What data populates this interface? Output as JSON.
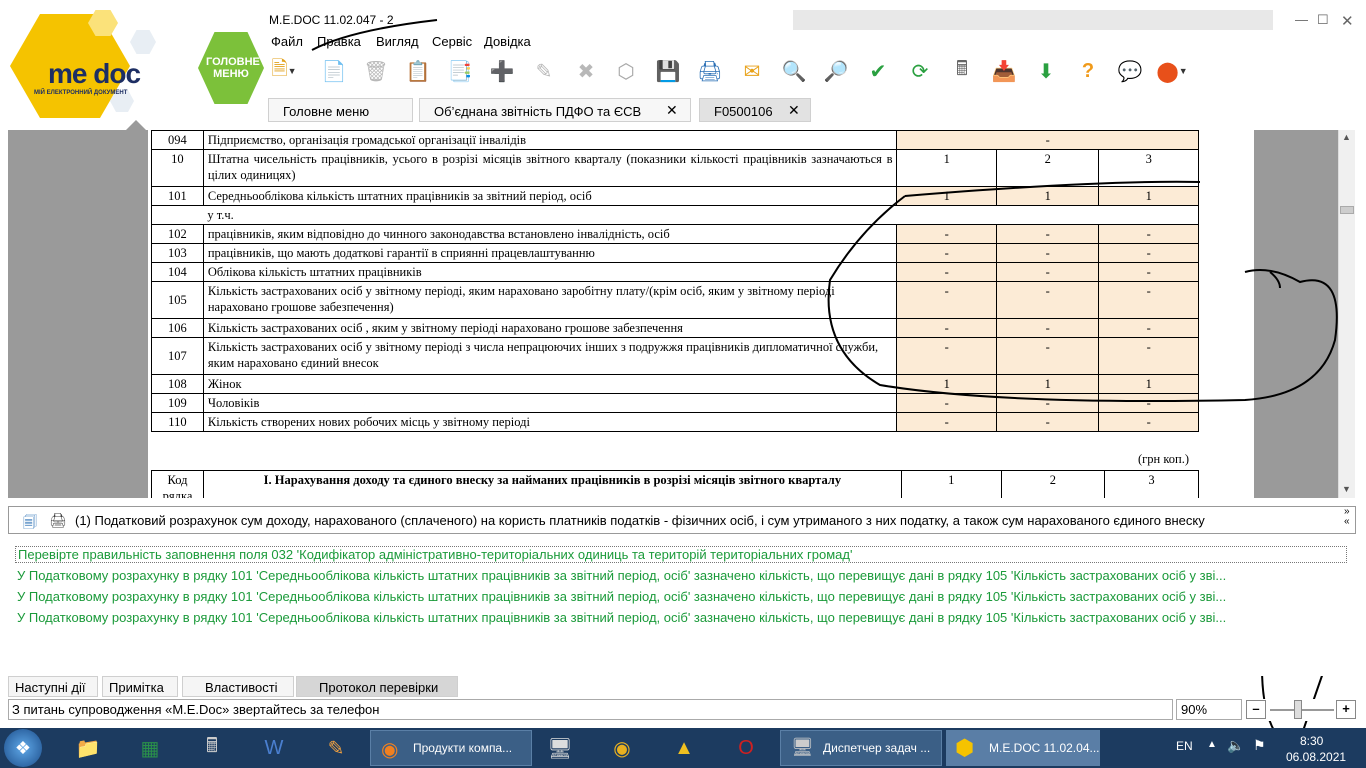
{
  "window": {
    "title": "M.E.DOC 11.02.047 - 2"
  },
  "logo": {
    "brand": "me doc",
    "tagline": "МІЙ ЕЛЕКТРОННИЙ ДОКУМЕНТ",
    "main_menu_badge": "ГОЛОВНЕ МЕНЮ"
  },
  "menu": [
    "Файл",
    "Правка",
    "Вигляд",
    "Сервіс",
    "Довідка"
  ],
  "toolbar_icons": [
    "new-document-icon",
    "open-icon",
    "delete-icon",
    "copy-icon",
    "copy-multi-icon",
    "add-row-icon",
    "edit-row-icon",
    "delete-row-icon",
    "network-icon",
    "save-icon",
    "print-icon",
    "send-icon",
    "find-icon",
    "search-icon",
    "check-icon",
    "refresh-icon",
    "calculator-icon",
    "archive-icon",
    "download-icon",
    "help-icon",
    "question-chat-icon",
    "message-icon"
  ],
  "tabs": [
    {
      "label": "Головне меню",
      "closable": false
    },
    {
      "label": "Об’єднана звітність ПДФО та ЄСВ",
      "closable": true
    },
    {
      "label": "F0500106",
      "closable": true
    }
  ],
  "form": {
    "rows": [
      {
        "code": "094",
        "desc": "Підприємство, організація громадської   організації інвалідів",
        "merged": "-"
      },
      {
        "code": "10",
        "desc": "Штатна чисельність працівників, усього в розрізі місяців звітного кварталу (показники кількості працівників зазначаються в цілих одиницях)",
        "v1": "1",
        "v2": "2",
        "v3": "3",
        "header": true
      },
      {
        "code": "101",
        "desc": "Середньооблікова кількість штатних працівників за звітний період, осіб",
        "v1": "1",
        "v2": "1",
        "v3": "1"
      },
      {
        "code": "",
        "desc": "у т.ч.",
        "blank": true
      },
      {
        "code": "102",
        "desc": "працівників,  яким відповідно до чинного законодавства встановлено інвалідність, осіб",
        "v1": "-",
        "v2": "-",
        "v3": "-"
      },
      {
        "code": "103",
        "desc": "працівників, що мають додаткові гарантії в сприянні працевлаштуванню",
        "v1": "-",
        "v2": "-",
        "v3": "-"
      },
      {
        "code": "104",
        "desc": "Облікова кількість штатних працівників",
        "v1": "-",
        "v2": "-",
        "v3": "-"
      },
      {
        "code": "105",
        "desc": "Кількість застрахованих осіб у звітному періоді, яким  нараховано заробітну  плату/(крім осіб, яким у звітному періоді нараховано грошове забезпечення)",
        "v1": "-",
        "v2": "-",
        "v3": "-"
      },
      {
        "code": "106",
        "desc": "Кількість застрахованих осіб , яким у звітному періоді нараховано грошове забезпечення",
        "v1": "-",
        "v2": "-",
        "v3": "-"
      },
      {
        "code": "107",
        "desc": "Кількість застрахованих осіб у звітному періоді з числа непрацюючих інших з   подружжя працівників дипломатичної служби,  яким  нараховано єдиний внесок",
        "v1": "-",
        "v2": "-",
        "v3": "-"
      },
      {
        "code": "108",
        "desc": "Жінок",
        "v1": "1",
        "v2": "1",
        "v3": "1"
      },
      {
        "code": "109",
        "desc": "Чоловіків",
        "v1": "-",
        "v2": "-",
        "v3": "-"
      },
      {
        "code": "110",
        "desc": "Кількість створених нових робочих місць  у звітному періоді",
        "v1": "-",
        "v2": "-",
        "v3": "-"
      }
    ],
    "currency_note": "(грн коп.)",
    "section_header": {
      "code": "Код рядка",
      "title": "I.  Нарахування доходу та єдиного внеску за найманих працівників в розрізі місяців звітного кварталу",
      "m1": "1",
      "m2": "2",
      "m3": "3"
    }
  },
  "status_line": {
    "text": "(1) Податковий розрахунок сум доходу, нарахованого (сплаченого) на користь платників податків - фізичних осіб, і сум утриманого з них податку, а також сум нарахованого єдиного внеску"
  },
  "messages": [
    "Перевірте правильність заповнення поля 032 'Кодифікатор адміністративно-територіальних одиниць та територій територіальних громад'",
    "У Податковому розрахунку в рядку 101 'Середньооблікова кількість штатних працівників за звітний період, осіб' зазначено кількість, що перевищує  дані в рядку 105 'Кількість застрахованих осіб у зві...",
    "У Податковому розрахунку в рядку 101 'Середньооблікова кількість штатних працівників за звітний період, осіб' зазначено кількість, що перевищує  дані в рядку 105 'Кількість застрахованих осіб у зві...",
    "У Податковому розрахунку в рядку 101 'Середньооблікова кількість штатних працівників за звітний період, осіб' зазначено кількість, що перевищує  дані в рядку 105 'Кількість застрахованих осіб у зві..."
  ],
  "bottom_tabs": [
    "Наступні дії",
    "Примітка",
    "Властивості",
    "Протокол перевірки"
  ],
  "bottom_status": {
    "support_text": "З питань супроводження «M.E.Doc» звертайтесь за телефон",
    "zoom": "90%"
  },
  "taskbar": {
    "buttons": [
      "Продукти компа...",
      "Диспетчер задач ...",
      "M.E.DOC 11.02.04..."
    ],
    "lang": "EN",
    "time": "8:30",
    "date": "06.08.2021"
  }
}
